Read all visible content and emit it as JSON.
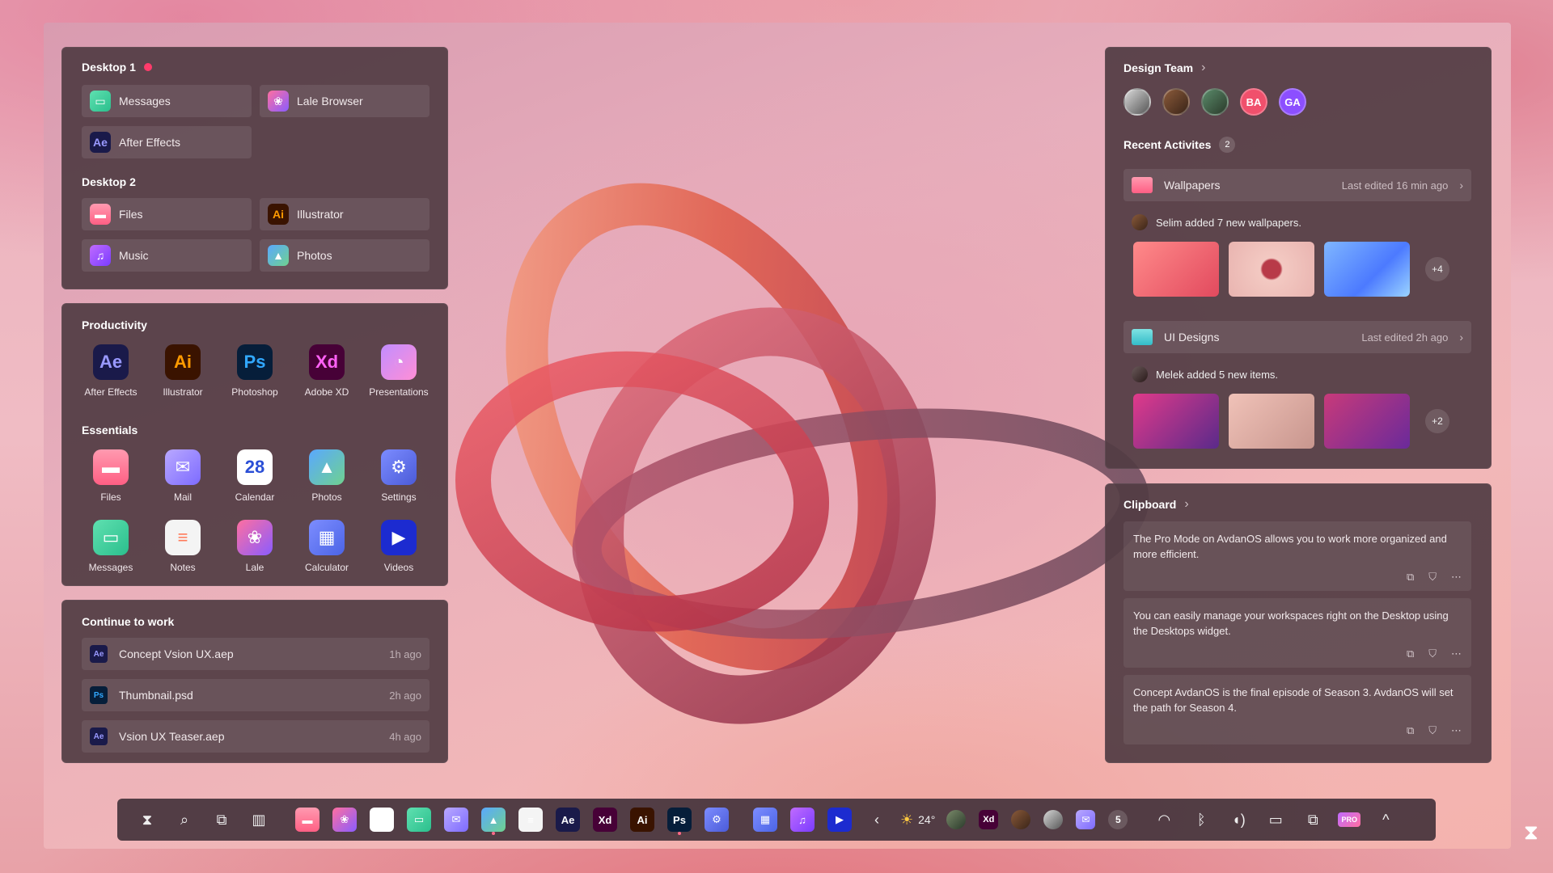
{
  "desktops": [
    {
      "title": "Desktop 1",
      "apps": [
        {
          "label": "Messages",
          "icon": "messages-icon",
          "glyph": "▭"
        },
        {
          "label": "Lale Browser",
          "icon": "lale-icon",
          "glyph": "❀"
        },
        {
          "label": "After Effects",
          "icon": "after-effects-icon",
          "glyph": "Ae"
        }
      ]
    },
    {
      "title": "Desktop 2",
      "apps": [
        {
          "label": "Files",
          "icon": "folder-icon",
          "glyph": "▬"
        },
        {
          "label": "Illustrator",
          "icon": "illustrator-icon",
          "glyph": "Ai"
        },
        {
          "label": "Music",
          "icon": "music-icon",
          "glyph": "♫"
        },
        {
          "label": "Photos",
          "icon": "photos-icon",
          "glyph": "▲"
        }
      ]
    }
  ],
  "productivity": {
    "title": "Productivity",
    "apps": [
      {
        "label": "After Effects",
        "glyph": "Ae"
      },
      {
        "label": "Illustrator",
        "glyph": "Ai"
      },
      {
        "label": "Photoshop",
        "glyph": "Ps"
      },
      {
        "label": "Adobe XD",
        "glyph": "Xd"
      },
      {
        "label": "Presentations",
        "glyph": "◔"
      }
    ]
  },
  "essentials": {
    "title": "Essentials",
    "apps": [
      {
        "label": "Files",
        "glyph": "▬"
      },
      {
        "label": "Mail",
        "glyph": "✉"
      },
      {
        "label": "Calendar",
        "glyph": "28"
      },
      {
        "label": "Photos",
        "glyph": "▲"
      },
      {
        "label": "Settings",
        "glyph": "⚙"
      },
      {
        "label": "Messages",
        "glyph": "▭"
      },
      {
        "label": "Notes",
        "glyph": "≡"
      },
      {
        "label": "Lale",
        "glyph": "❀"
      },
      {
        "label": "Calculator",
        "glyph": "▦"
      },
      {
        "label": "Videos",
        "glyph": "▶"
      }
    ]
  },
  "continue": {
    "title": "Continue to work",
    "items": [
      {
        "name": "Concept Vsion UX.aep",
        "time": "1h ago",
        "glyph": "Ae"
      },
      {
        "name": "Thumbnail.psd",
        "time": "2h ago",
        "glyph": "Ps"
      },
      {
        "name": "Vsion UX Teaser.aep",
        "time": "4h ago",
        "glyph": "Ae"
      }
    ]
  },
  "team": {
    "title": "Design Team",
    "chevron": "›",
    "avatars": [
      "",
      "",
      "",
      "BA",
      "GA"
    ],
    "recent_title": "Recent Activites",
    "recent_count": "2",
    "folders": [
      {
        "name": "Wallpapers",
        "meta": "Last edited 16 min ago",
        "note": "Selim added 7 new wallpapers.",
        "more": "+4"
      },
      {
        "name": "UI Designs",
        "meta": "Last edited 2h ago",
        "note": "Melek added 5 new items.",
        "more": "+2"
      }
    ]
  },
  "clipboard": {
    "title": "Clipboard",
    "chevron": "›",
    "items": [
      "The Pro Mode on AvdanOS allows you to work more organized and more efficient.",
      "You can easily manage your workspaces right on the Desktop using the Desktops widget.",
      "Concept AvdanOS is the final episode of Season 3. AvdanOS will set the path for Season 4."
    ],
    "actions": [
      "⧉",
      "⛉",
      "⋯"
    ]
  },
  "taskbar": {
    "weather": "24°",
    "notification_count": "5",
    "calendar_day": "28",
    "prev": "‹",
    "expand": "^",
    "pro_badge": "PRO"
  },
  "colors": {
    "panel": "#523c44",
    "accent_pink": "#ff5f84",
    "record_dot": "#ff3b6b"
  }
}
